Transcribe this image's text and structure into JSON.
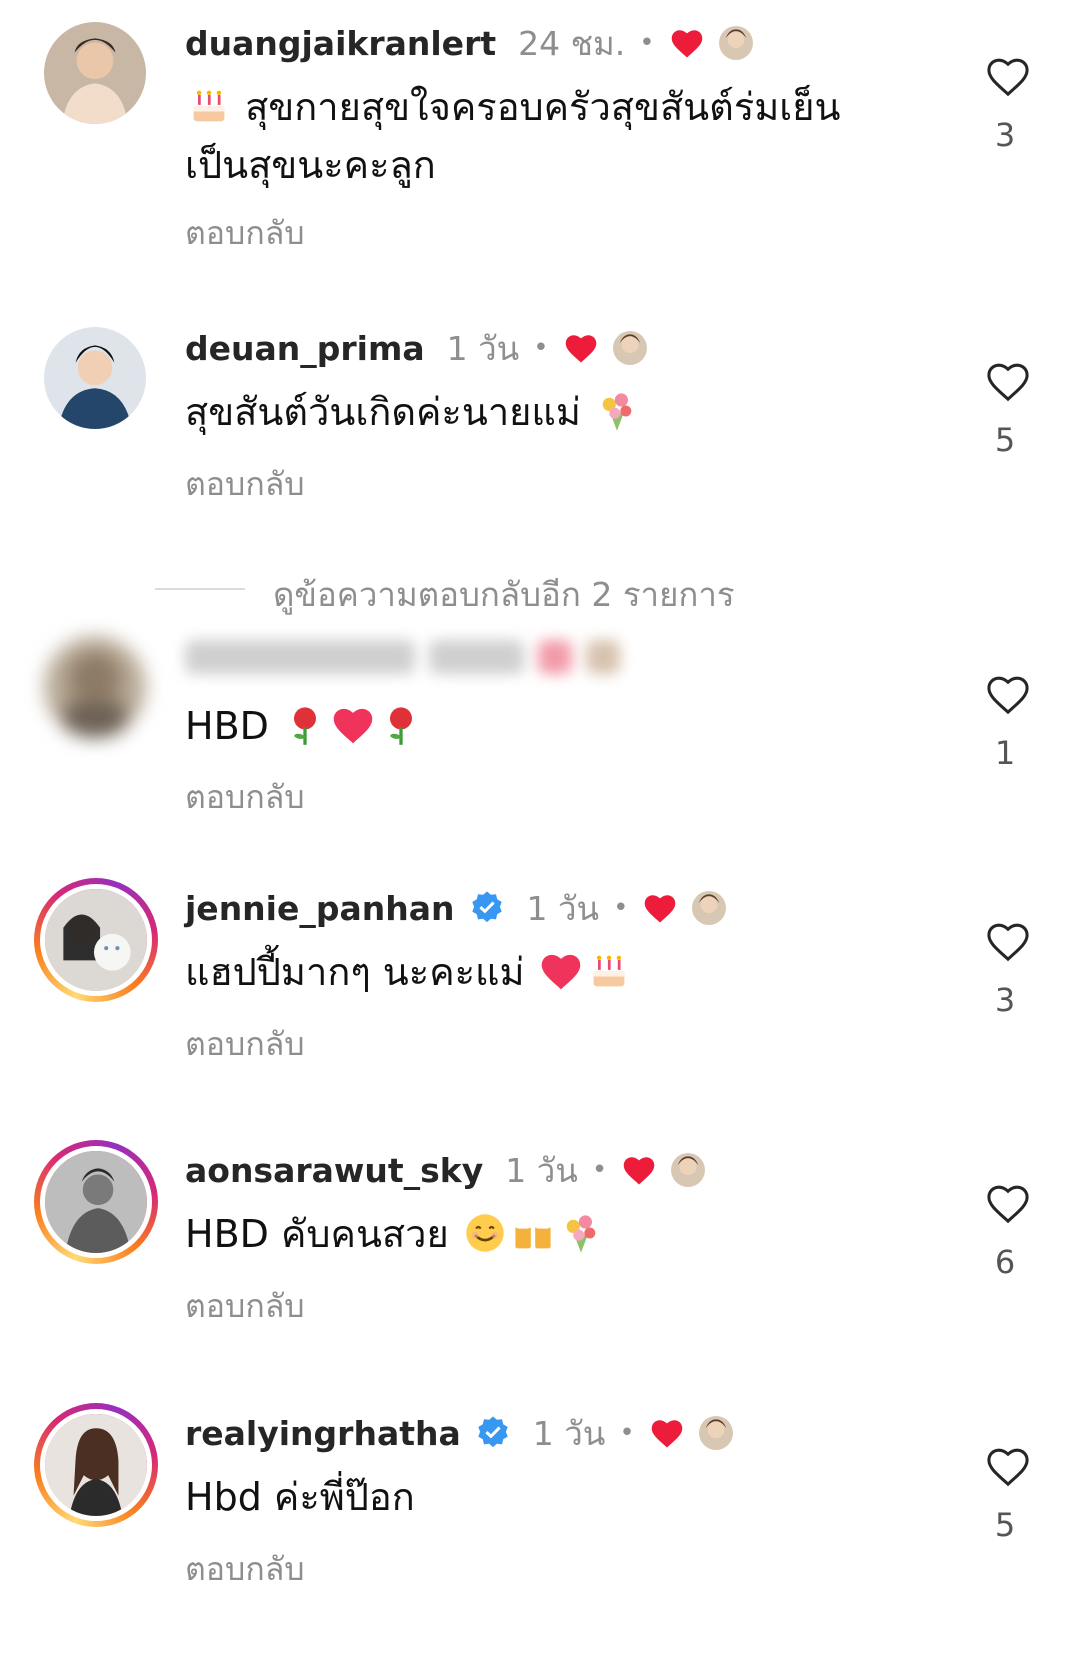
{
  "reply_label": "ตอบกลับ",
  "view_more_replies": "ดูข้อความตอบกลับอีก 2 รายการ",
  "colors": {
    "like_red": "#ed1c3a",
    "verified_blue": "#3897f0",
    "meta_gray": "#8e8e8e"
  },
  "comments": [
    {
      "username": "duangjaikranlert",
      "time": "24 ชม.",
      "verified": false,
      "text": "สุขกายสุขใจครอบครัวสุขสันต์ร่มเย็นเป็นสุขนะคะลูก",
      "leading_emoji": "birthday-cake",
      "likes": "3"
    },
    {
      "username": "deuan_prima",
      "time": "1 วัน",
      "verified": false,
      "text": "สุขสันต์วันเกิดค่ะนายแม่",
      "trailing_emoji": "bouquet",
      "likes": "5"
    },
    {
      "username": "",
      "time": "",
      "verified": false,
      "text": "HBD",
      "trailing_emoji": "rose heart rose",
      "likes": "1",
      "blurred": true
    },
    {
      "username": "jennie_panhan",
      "time": "1 วัน",
      "verified": true,
      "text": "แฮปปี้มากๆ นะคะแม่",
      "trailing_emoji": "heart birthday-cake",
      "likes": "3"
    },
    {
      "username": "aonsarawut_sky",
      "time": "1 วัน",
      "verified": false,
      "text": "HBD คับคนสวย",
      "trailing_emoji": "smile beer bouquet",
      "likes": "6"
    },
    {
      "username": "realyingrhatha",
      "time": "1 วัน",
      "verified": true,
      "text": "Hbd ค่ะพี่ป๊อก",
      "likes": "5"
    }
  ]
}
